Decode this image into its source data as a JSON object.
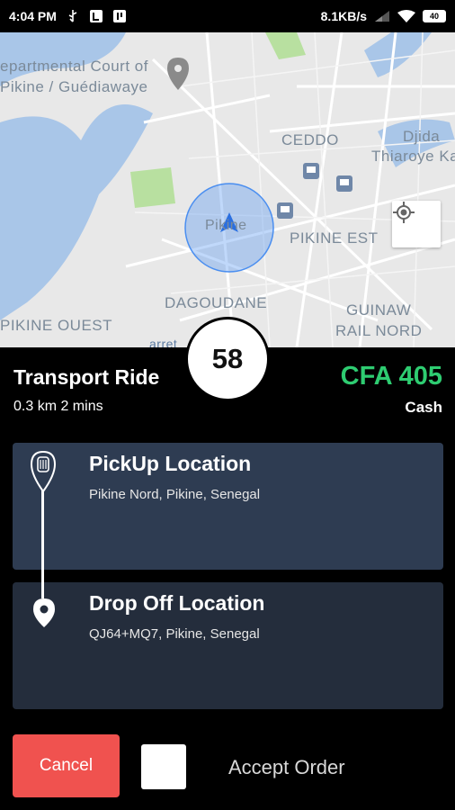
{
  "status_bar": {
    "time": "4:04 PM",
    "network_speed": "8.1KB/s",
    "battery": "40",
    "icons": [
      "usb-icon",
      "n-app-icon",
      "app-store-icon",
      "signal-icon",
      "wifi-icon",
      "battery-icon"
    ]
  },
  "map": {
    "labels": {
      "court_line1": "epartmental Court of",
      "court_line2": "Pikine / Guédiawaye",
      "ceddo": "CEDDO",
      "djida_line1": "Djida",
      "djida_line2": "Thiaroye Ka",
      "pikine_center": "Pikine",
      "pikine_est": "PIKINE EST",
      "dagoudane": "DAGOUDANE",
      "guinaw_line1": "GUINAW",
      "guinaw_line2": "RAIL NORD",
      "pikine_ouest": "PIKINE OUEST",
      "arret": "arret"
    },
    "colors": {
      "water": "#a9c6e8",
      "park": "#b8e0a0",
      "land": "#e9e9e9",
      "road": "#ffffff",
      "accuracy": "#4a8ef0"
    }
  },
  "ride": {
    "counter": "58",
    "title": "Transport Ride",
    "meta": "0.3 km 2 mins",
    "fare": "CFA 405",
    "payment": "Cash"
  },
  "pickup": {
    "title": "PickUp Location",
    "address": "Pikine Nord, Pikine, Senegal"
  },
  "dropoff": {
    "title": "Drop Off Location",
    "address": "QJ64+MQ7, Pikine, Senegal"
  },
  "actions": {
    "cancel": "Cancel",
    "accept": "Accept Order"
  },
  "theme": {
    "fare_color": "#2ecc71",
    "cancel_color": "#f0524f",
    "pickup_card": "#2e3c52",
    "drop_card": "#242d3c"
  }
}
